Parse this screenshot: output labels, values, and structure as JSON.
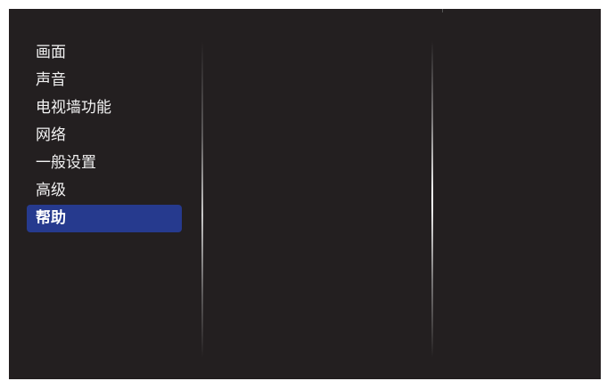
{
  "top_fragment": "帮助",
  "menu": {
    "items": [
      {
        "label": "画面",
        "selected": false
      },
      {
        "label": "声音",
        "selected": false
      },
      {
        "label": "电视墙功能",
        "selected": false
      },
      {
        "label": "网络",
        "selected": false
      },
      {
        "label": "一般设置",
        "selected": false
      },
      {
        "label": "高级",
        "selected": false
      },
      {
        "label": "帮助",
        "selected": true
      }
    ]
  },
  "colors": {
    "background": "#231f20",
    "selected_highlight": "#263a8e",
    "text": "#f2f2f2"
  }
}
